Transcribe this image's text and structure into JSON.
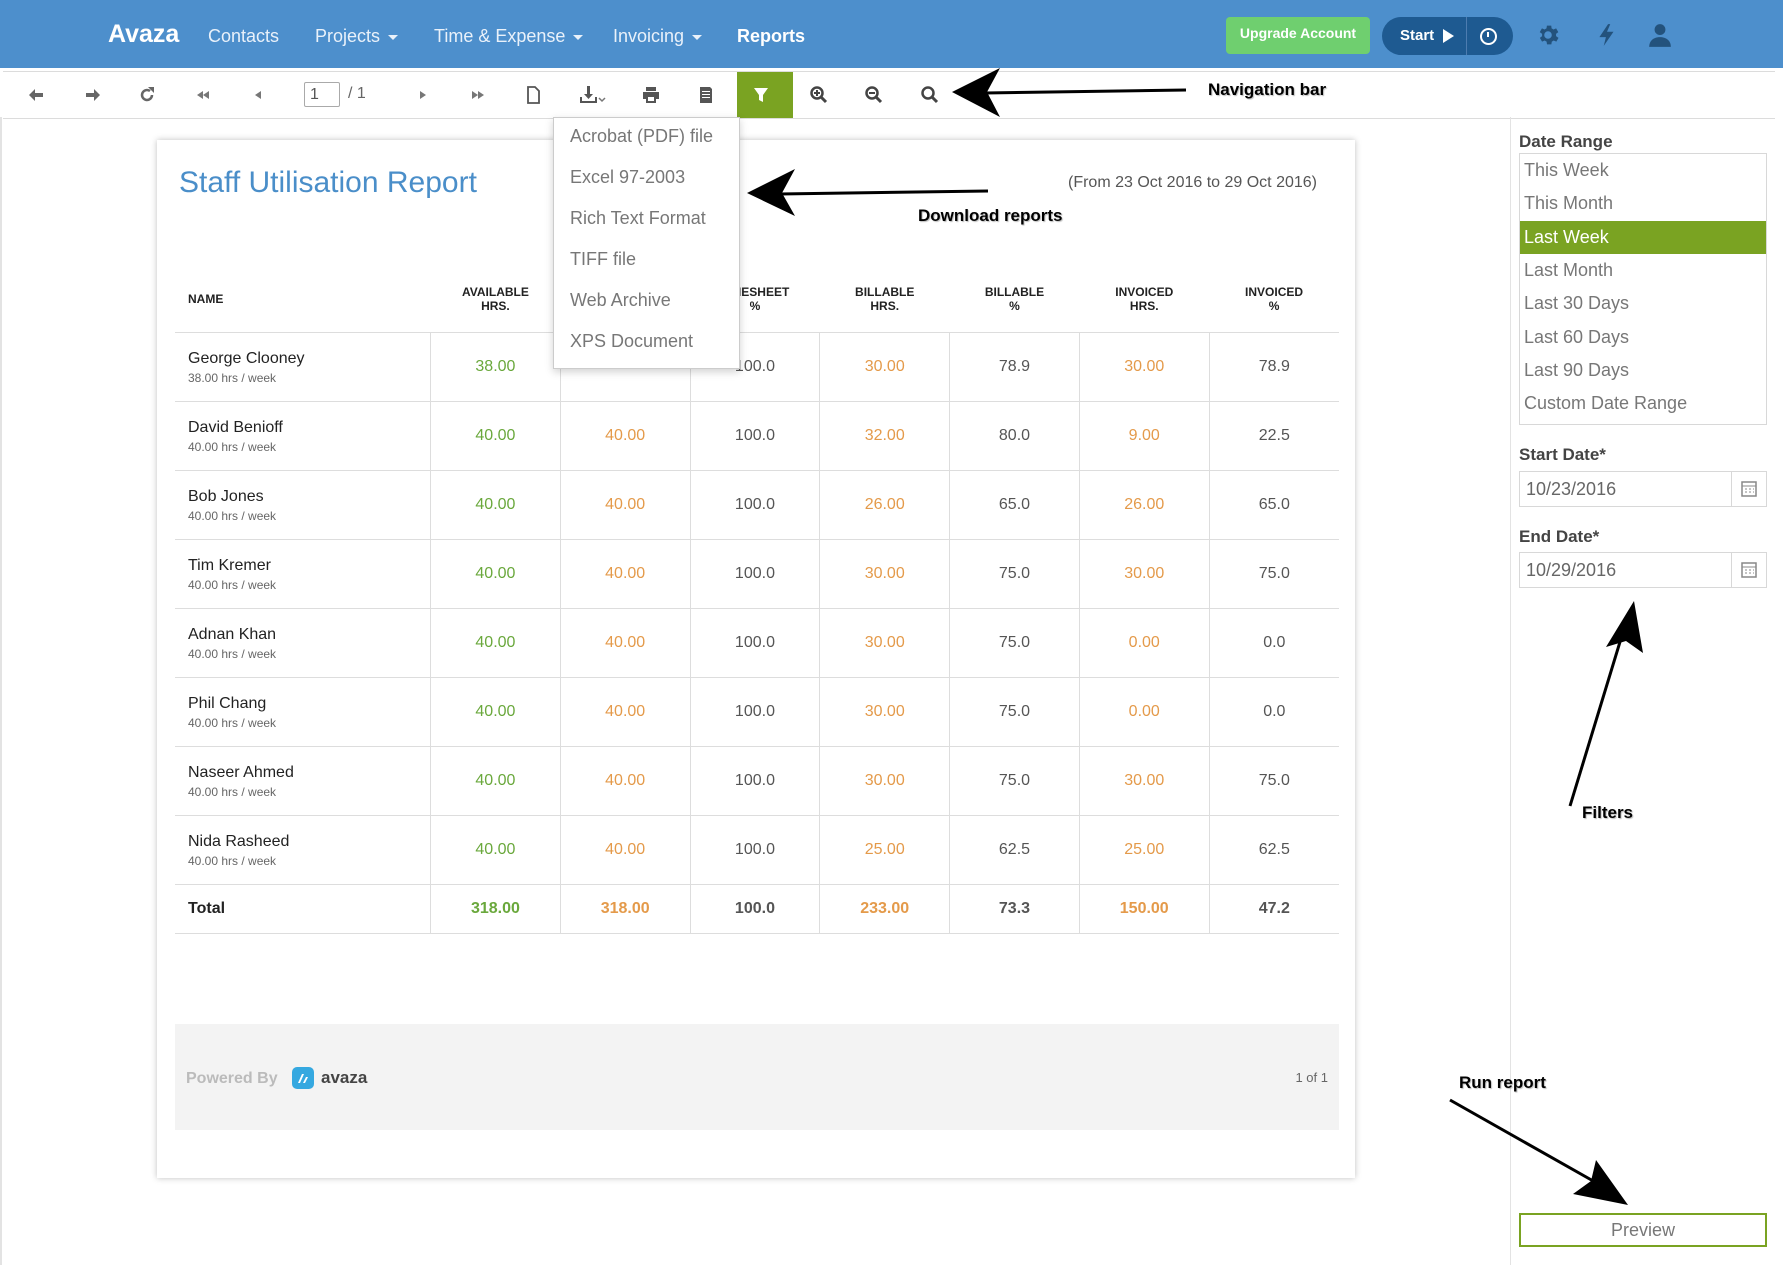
{
  "header": {
    "brand": "Avaza",
    "nav": [
      {
        "label": "Contacts",
        "dropdown": false
      },
      {
        "label": "Projects",
        "dropdown": true
      },
      {
        "label": "Time & Expense",
        "dropdown": true
      },
      {
        "label": "Invoicing",
        "dropdown": true
      },
      {
        "label": "Reports",
        "dropdown": false,
        "active": true
      }
    ],
    "upgrade_label": "Upgrade Account",
    "start_label": "Start",
    "icons": [
      "gear-icon",
      "lightning-icon",
      "user-icon"
    ]
  },
  "toolbar": {
    "icons": [
      "back-icon",
      "forward-icon",
      "refresh-icon",
      "first-page-icon",
      "previous-page-icon",
      "next-page-icon",
      "last-page-icon",
      "document-icon",
      "download-icon",
      "print-icon",
      "print-page-icon",
      "filter-icon",
      "zoom-in-icon",
      "zoom-out-icon",
      "search-icon"
    ],
    "page_value": "1",
    "page_total": "/ 1"
  },
  "download_menu": {
    "items": [
      "Acrobat (PDF) file",
      "Excel 97-2003",
      "Rich Text Format",
      "TIFF file",
      "Web Archive",
      "XPS Document"
    ]
  },
  "report": {
    "title": "Staff Utilisation Report",
    "range": "(From 23 Oct 2016 to 29 Oct 2016)",
    "columns": [
      {
        "l1": "NAME",
        "l2": ""
      },
      {
        "l1": "AVAILABLE",
        "l2": "HRS."
      },
      {
        "l1": "",
        "l2": ""
      },
      {
        "l1": "TIMESHEET",
        "l2": "%"
      },
      {
        "l1": "BILLABLE",
        "l2": "HRS."
      },
      {
        "l1": "BILLABLE",
        "l2": "%"
      },
      {
        "l1": "INVOICED",
        "l2": "HRS."
      },
      {
        "l1": "INVOICED",
        "l2": "%"
      }
    ],
    "rows": [
      {
        "name": "George Clooney",
        "sub": "38.00 hrs / week",
        "cells": [
          "38.00",
          "",
          "100.0",
          "30.00",
          "78.9",
          "30.00",
          "78.9"
        ]
      },
      {
        "name": "David Benioff",
        "sub": "40.00 hrs / week",
        "cells": [
          "40.00",
          "40.00",
          "100.0",
          "32.00",
          "80.0",
          "9.00",
          "22.5"
        ]
      },
      {
        "name": "Bob Jones",
        "sub": "40.00 hrs / week",
        "cells": [
          "40.00",
          "40.00",
          "100.0",
          "26.00",
          "65.0",
          "26.00",
          "65.0"
        ]
      },
      {
        "name": "Tim Kremer",
        "sub": "40.00 hrs / week",
        "cells": [
          "40.00",
          "40.00",
          "100.0",
          "30.00",
          "75.0",
          "30.00",
          "75.0"
        ]
      },
      {
        "name": "Adnan Khan",
        "sub": "40.00 hrs / week",
        "cells": [
          "40.00",
          "40.00",
          "100.0",
          "30.00",
          "75.0",
          "0.00",
          "0.0"
        ]
      },
      {
        "name": "Phil Chang",
        "sub": "40.00 hrs / week",
        "cells": [
          "40.00",
          "40.00",
          "100.0",
          "30.00",
          "75.0",
          "0.00",
          "0.0"
        ]
      },
      {
        "name": "Naseer Ahmed",
        "sub": "40.00 hrs / week",
        "cells": [
          "40.00",
          "40.00",
          "100.0",
          "30.00",
          "75.0",
          "30.00",
          "75.0"
        ]
      },
      {
        "name": "Nida Rasheed",
        "sub": "40.00 hrs / week",
        "cells": [
          "40.00",
          "40.00",
          "100.0",
          "25.00",
          "62.5",
          "25.00",
          "62.5"
        ]
      }
    ],
    "total": {
      "label": "Total",
      "cells": [
        "318.00",
        "318.00",
        "100.0",
        "233.00",
        "73.3",
        "150.00",
        "47.2"
      ]
    },
    "cell_colors": [
      "green",
      "orange",
      "",
      "orange",
      "",
      "orange",
      ""
    ],
    "footer": {
      "powered_by": "Powered By",
      "logo_text": "avaza",
      "page_of": "1 of 1"
    }
  },
  "filters": {
    "date_range_label": "Date Range",
    "ranges": [
      "This Week",
      "This Month",
      "Last Week",
      "Last Month",
      "Last 30 Days",
      "Last 60 Days",
      "Last 90 Days",
      "Custom Date Range"
    ],
    "selected_range": "Last Week",
    "start_label": "Start Date*",
    "start_value": "10/23/2016",
    "end_label": "End Date*",
    "end_value": "10/29/2016",
    "preview_label": "Preview"
  },
  "annotations": {
    "navigation_bar": "Navigation bar",
    "download_reports": "Download reports",
    "filters": "Filters",
    "run_report": "Run report"
  },
  "colors": {
    "header_bg": "#4d8fcc",
    "accent_green": "#7aa322",
    "upgrade_green": "#6fcf6f",
    "value_green": "#6aa83c",
    "value_orange": "#e49a4a",
    "title_blue": "#4a8ec9"
  }
}
